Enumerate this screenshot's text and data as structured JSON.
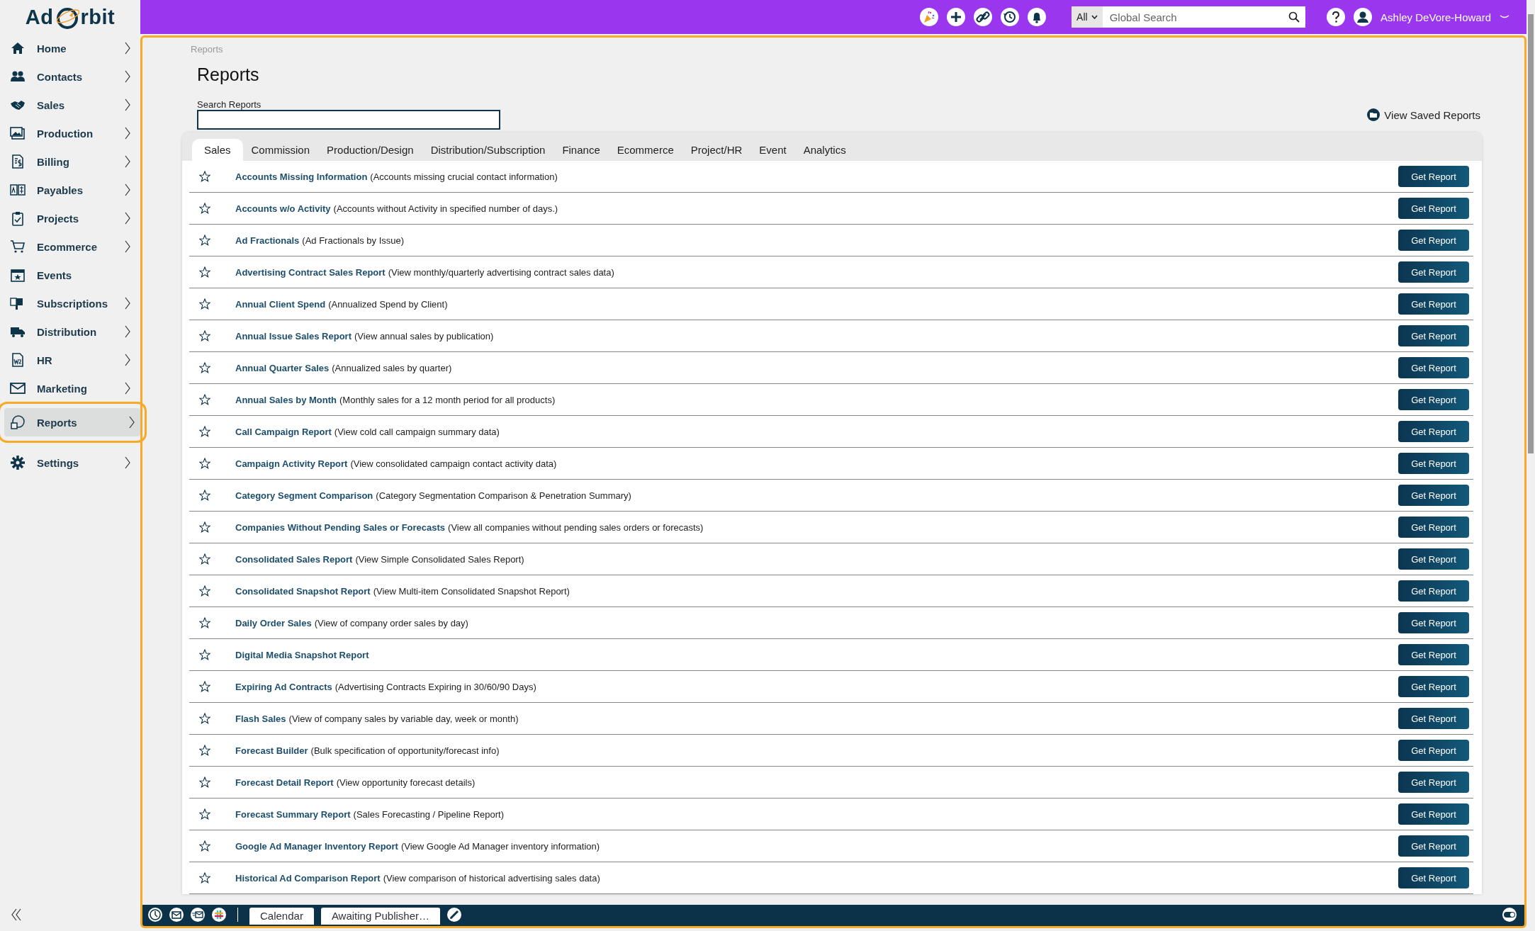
{
  "logo": {
    "parts": [
      "Ad",
      "rbit"
    ]
  },
  "sidebar": {
    "items": [
      {
        "label": "Home",
        "has_submenu": true,
        "selected": false,
        "highlighted": false
      },
      {
        "label": "Contacts",
        "has_submenu": true,
        "selected": false,
        "highlighted": false
      },
      {
        "label": "Sales",
        "has_submenu": true,
        "selected": false,
        "highlighted": false
      },
      {
        "label": "Production",
        "has_submenu": true,
        "selected": false,
        "highlighted": false
      },
      {
        "label": "Billing",
        "has_submenu": true,
        "selected": false,
        "highlighted": false
      },
      {
        "label": "Payables",
        "has_submenu": true,
        "selected": false,
        "highlighted": false
      },
      {
        "label": "Projects",
        "has_submenu": true,
        "selected": false,
        "highlighted": false
      },
      {
        "label": "Ecommerce",
        "has_submenu": true,
        "selected": false,
        "highlighted": false
      },
      {
        "label": "Events",
        "has_submenu": false,
        "selected": false,
        "highlighted": false
      },
      {
        "label": "Subscriptions",
        "has_submenu": true,
        "selected": false,
        "highlighted": false
      },
      {
        "label": "Distribution",
        "has_submenu": true,
        "selected": false,
        "highlighted": false
      },
      {
        "label": "HR",
        "has_submenu": true,
        "selected": false,
        "highlighted": false
      },
      {
        "label": "Marketing",
        "has_submenu": true,
        "selected": false,
        "highlighted": false
      },
      {
        "label": "Reports",
        "has_submenu": true,
        "selected": true,
        "highlighted": true
      },
      {
        "label": "Settings",
        "has_submenu": true,
        "selected": false,
        "highlighted": false
      }
    ]
  },
  "top_bar": {
    "search_scope": "All",
    "search": {
      "placeholder": "Global Search"
    },
    "user_name": "Ashley DeVore-Howard"
  },
  "breadcrumb": "Reports",
  "page_title": "Reports",
  "search_reports": {
    "label": "Search Reports"
  },
  "view_saved_reports": "View Saved Reports",
  "tabs": [
    {
      "label": "Sales",
      "selected": true
    },
    {
      "label": "Commission",
      "selected": false
    },
    {
      "label": "Production/Design",
      "selected": false
    },
    {
      "label": "Distribution/Subscription",
      "selected": false
    },
    {
      "label": "Finance",
      "selected": false
    },
    {
      "label": "Ecommerce",
      "selected": false
    },
    {
      "label": "Project/HR",
      "selected": false
    },
    {
      "label": "Event",
      "selected": false
    },
    {
      "label": "Analytics",
      "selected": false
    }
  ],
  "reports": [
    {
      "title": "Accounts Missing Information",
      "description": "(Accounts missing crucial contact information)",
      "starred": false,
      "button": "Get Report"
    },
    {
      "title": "Accounts w/o Activity",
      "description": "(Accounts without Activity in specified number of days.)",
      "starred": false,
      "button": "Get Report"
    },
    {
      "title": "Ad Fractionals",
      "description": "(Ad Fractionals by Issue)",
      "starred": false,
      "button": "Get Report"
    },
    {
      "title": "Advertising Contract Sales Report",
      "description": "(View monthly/quarterly advertising contract sales data)",
      "starred": false,
      "button": "Get Report"
    },
    {
      "title": "Annual Client Spend",
      "description": "(Annualized Spend by Client)",
      "starred": false,
      "button": "Get Report"
    },
    {
      "title": "Annual Issue Sales Report",
      "description": "(View annual sales by publication)",
      "starred": false,
      "button": "Get Report"
    },
    {
      "title": "Annual Quarter Sales",
      "description": "(Annualized sales by quarter)",
      "starred": false,
      "button": "Get Report"
    },
    {
      "title": "Annual Sales by Month",
      "description": "(Monthly sales for a 12 month period for all products)",
      "starred": false,
      "button": "Get Report"
    },
    {
      "title": "Call Campaign Report",
      "description": "(View cold call campaign summary data)",
      "starred": false,
      "button": "Get Report"
    },
    {
      "title": "Campaign Activity Report",
      "description": "(View consolidated campaign contact activity data)",
      "starred": false,
      "button": "Get Report"
    },
    {
      "title": "Category Segment Comparison",
      "description": "(Category Segmentation Comparison & Penetration Summary)",
      "starred": false,
      "button": "Get Report"
    },
    {
      "title": "Companies Without Pending Sales or Forecasts",
      "description": "(View all companies without pending sales orders or forecasts)",
      "starred": false,
      "button": "Get Report"
    },
    {
      "title": "Consolidated Sales Report",
      "description": "(View Simple Consolidated Sales Report)",
      "starred": false,
      "button": "Get Report"
    },
    {
      "title": "Consolidated Snapshot Report",
      "description": "(View Multi-item Consolidated Snapshot Report)",
      "starred": false,
      "button": "Get Report"
    },
    {
      "title": "Daily Order Sales",
      "description": "(View of company order sales by day)",
      "starred": false,
      "button": "Get Report"
    },
    {
      "title": "Digital Media Snapshot Report",
      "starred": false,
      "button": "Get Report"
    },
    {
      "title": "Expiring Ad Contracts",
      "description": "(Advertising Contracts Expiring in 30/60/90 Days)",
      "starred": false,
      "button": "Get Report"
    },
    {
      "title": "Flash Sales",
      "description": "(View of company sales by variable day, week or month)",
      "starred": false,
      "button": "Get Report"
    },
    {
      "title": "Forecast Builder",
      "description": "(Bulk specification of opportunity/forecast info)",
      "starred": false,
      "button": "Get Report"
    },
    {
      "title": "Forecast Detail Report",
      "description": "(View opportunity forecast details)",
      "starred": false,
      "button": "Get Report"
    },
    {
      "title": "Forecast Summary Report",
      "description": "(Sales Forecasting / Pipeline Report)",
      "starred": false,
      "button": "Get Report"
    },
    {
      "title": "Google Ad Manager Inventory Report",
      "description": "(View Google Ad Manager inventory information)",
      "starred": false,
      "button": "Get Report"
    },
    {
      "title": "Historical Ad Comparison Report",
      "description": "(View comparison of historical advertising sales data)",
      "starred": false,
      "button": "Get Report"
    }
  ],
  "bottom_bar": {
    "tabs": [
      "Calendar",
      "Awaiting Publisher…"
    ]
  }
}
